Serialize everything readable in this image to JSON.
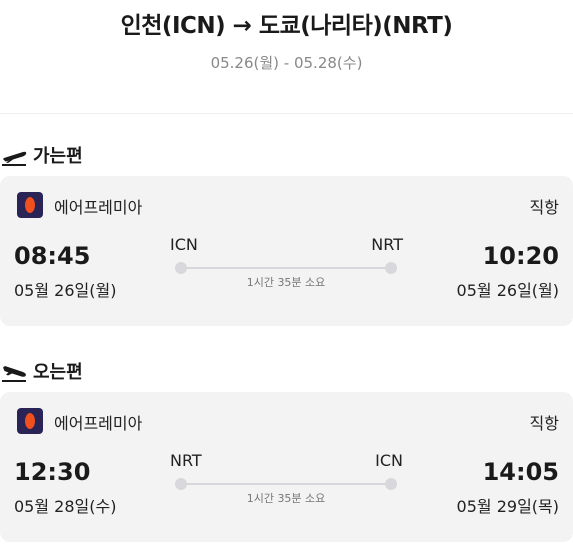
{
  "header": {
    "title": "인천(ICN) → 도쿄(나리타)(NRT)",
    "dates": "05.26(월) - 05.28(수)"
  },
  "outbound": {
    "section_label": "가는편",
    "icon": "plane-departure-icon",
    "airline": "에어프레미아",
    "flight_type": "직항",
    "departure": {
      "time": "08:45",
      "date": "05월 26일(월)",
      "code": "ICN"
    },
    "arrival": {
      "time": "10:20",
      "date": "05월 26일(월)",
      "code": "NRT"
    },
    "duration": "1시간 35분 소요"
  },
  "inbound": {
    "section_label": "오는편",
    "icon": "plane-arrival-icon",
    "airline": "에어프레미아",
    "flight_type": "직항",
    "departure": {
      "time": "12:30",
      "date": "05월 28일(수)",
      "code": "NRT"
    },
    "arrival": {
      "time": "14:05",
      "date": "05월 29일(목)",
      "code": "ICN"
    },
    "duration": "1시간 35분 소요"
  },
  "colors": {
    "card_background": "#f3f3f4",
    "airline_logo_bg": "#2a2356",
    "airline_logo_accent": "#f0501e"
  }
}
